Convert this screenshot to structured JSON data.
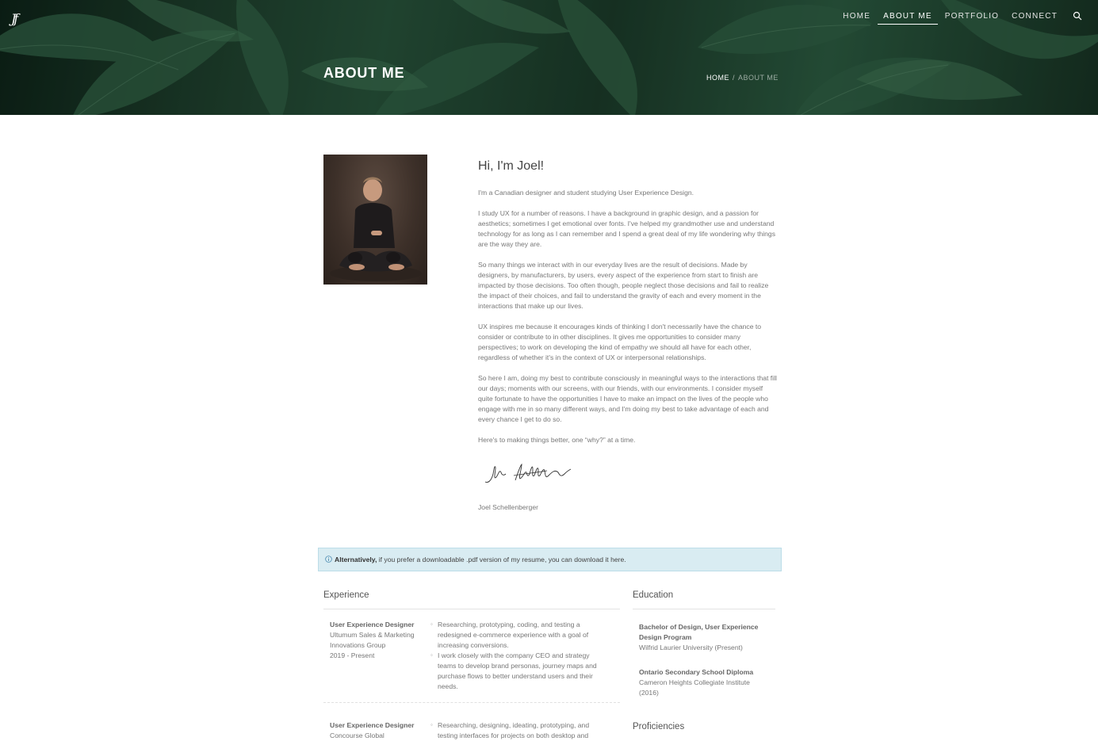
{
  "header": {
    "logo_text": "Jf",
    "nav": [
      {
        "label": "HOME"
      },
      {
        "label": "ABOUT ME"
      },
      {
        "label": "PORTFOLIO"
      },
      {
        "label": "CONNECT"
      }
    ],
    "search_icon": "search-icon",
    "page_title": "ABOUT ME",
    "breadcrumb": {
      "home": "HOME",
      "separator": "/",
      "current": "ABOUT ME"
    }
  },
  "intro": {
    "heading": "Hi, I'm Joel!",
    "paragraphs": [
      "I'm a Canadian designer and student studying User Experience Design.",
      "I study UX for a number of reasons. I have a background in graphic design, and a passion for aesthetics; sometimes I get emotional over fonts. I've helped my grandmother use and understand technology for as long as I can remember and I spend a great deal of my life wondering why things are the way they are.",
      "So many things we interact with in our everyday lives are the result of decisions. Made by designers, by manufacturers, by users, every aspect of the experience from start to finish are impacted by those decisions. Too often though, people neglect those decisions and fail to realize the impact of their choices, and fail to understand the gravity of each and every moment in the interactions that make up our lives.",
      "UX inspires me because it encourages kinds of thinking I don't necessarily have the chance to consider or contribute to in other disciplines. It gives me opportunities to consider many perspectives; to work on developing the kind of empathy we should all have for each other, regardless of whether it's in the context of UX or interpersonal relationships.",
      "So here I am, doing my best to contribute consciously in meaningful ways to the interactions that fill our days; moments with our screens, with our friends, with our environments. I consider myself quite fortunate to have the opportunities I have to make an impact on the lives of the people who engage with me in so many different ways, and I'm doing my best to take advantage of each and every chance I get to do so.",
      "Here's to making things better, one “why?” at a time."
    ],
    "signature_name": "Joel Schellenberger"
  },
  "alert": {
    "bold": "Alternatively,",
    "text": " if you prefer a downloadable .pdf version of my resume, you can download it here."
  },
  "experience": {
    "title": "Experience",
    "jobs": [
      {
        "role": "User Experience Designer",
        "company": "Ultumum Sales & Marketing Innovations Group",
        "dates": "2019 - Present",
        "bullets": [
          "Researching, prototyping, coding, and testing a redesigned e-commerce experience with a goal of increasing conversions.",
          "I work closely with the company CEO and strategy teams to develop brand personas, journey maps and purchase flows to better understand users and their needs."
        ]
      },
      {
        "role": "User Experience Designer",
        "company": "Concourse Global",
        "dates": "",
        "bullets": [
          "Researching, designing, ideating, prototyping, and testing interfaces for projects on both desktop and"
        ]
      }
    ]
  },
  "education": {
    "title": "Education",
    "items": [
      {
        "degree": "Bachelor of Design, User Experience Design Program",
        "school": "Wilfrid Laurier University (Present)"
      },
      {
        "degree": "Ontario Secondary School Diploma",
        "school": "Cameron Heights Collegiate Institute (2016)"
      }
    ]
  },
  "proficiencies": {
    "title": "Proficiencies"
  },
  "colors": {
    "accent_alert_bg": "#d9ecf2",
    "hero_green": "#27523a",
    "text": "#777777"
  }
}
